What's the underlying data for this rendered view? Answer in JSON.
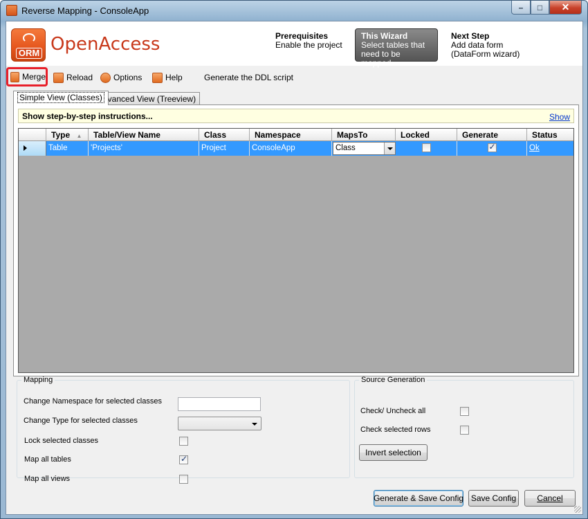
{
  "window": {
    "title": "Reverse Mapping - ConsoleApp",
    "min": "–",
    "max": "□",
    "close": "✕"
  },
  "header": {
    "logo_text": "ORM",
    "brand": "OpenAccess",
    "steps": [
      {
        "title": "Prerequisites",
        "lines": [
          "Enable the project"
        ]
      },
      {
        "title": "This Wizard",
        "lines": [
          "Select tables that",
          "need to be mapped"
        ]
      },
      {
        "title": "Next Step",
        "lines": [
          "Add data form",
          "(DataForm wizard)"
        ]
      }
    ]
  },
  "toolbar": {
    "merge": "Merge",
    "reload": "Reload",
    "options": "Options",
    "help": "Help",
    "generate_ddl": "Generate the DDL script"
  },
  "tabs": [
    "Simple View (Classes)",
    "Advanced View (Treeview)"
  ],
  "instructions": {
    "text": "Show step-by-step instructions...",
    "show": "Show"
  },
  "grid": {
    "columns": [
      "Type",
      "Table/View Name",
      "Class",
      "Namespace",
      "MapsTo",
      "Locked",
      "Generate",
      "Status"
    ],
    "rows": [
      {
        "type": "Table",
        "name": "'Projects'",
        "class": "Project",
        "namespace": "ConsoleApp",
        "maps_to": "Class",
        "locked": false,
        "generate": true,
        "status": "Ok"
      }
    ]
  },
  "mapping": {
    "legend": "Mapping",
    "change_namespace": "Change Namespace for selected classes",
    "change_type": "Change Type for selected classes",
    "lock_selected": "Lock selected classes",
    "map_all_tables": "Map all tables",
    "map_all_views": "Map all views",
    "map_all_tables_checked": true,
    "map_all_views_checked": false,
    "lock_selected_checked": false
  },
  "source_generation": {
    "legend": "Source Generation",
    "check_uncheck_all": "Check/ Uncheck all",
    "check_selected_rows": "Check selected rows",
    "invert_selection": "Invert selection"
  },
  "footer": {
    "generate_save": "Generate & Save Config",
    "save_config": "Save Config",
    "cancel": "Cancel"
  }
}
